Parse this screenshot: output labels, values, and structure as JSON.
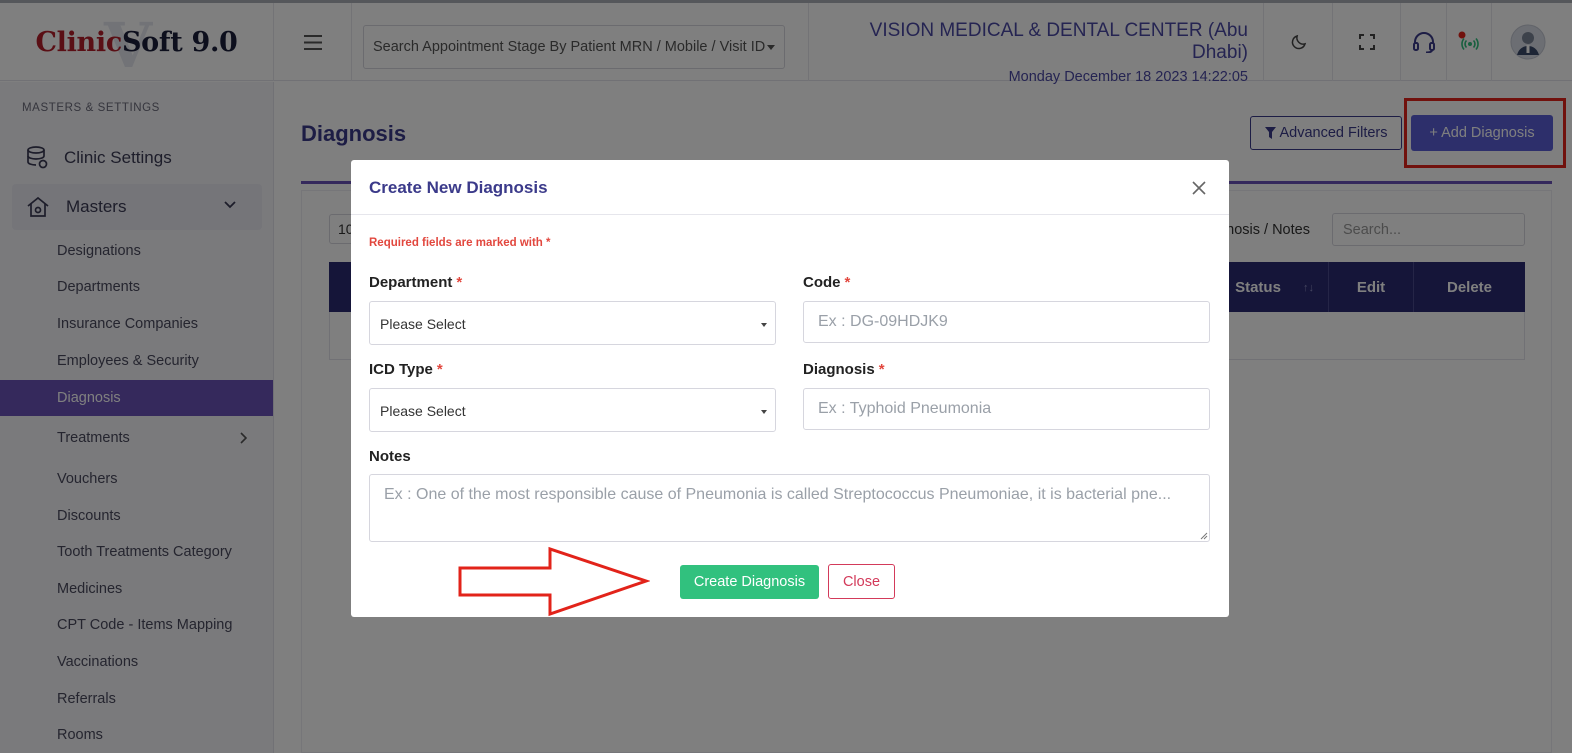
{
  "header": {
    "logo_part1": "Clinic",
    "logo_part2": "Soft",
    "logo_version": " 9.0",
    "logo_watermark": "V",
    "search_placeholder": "Search Appointment Stage By Patient MRN / Mobile / Visit ID",
    "clinic_name": "VISION MEDICAL & DENTAL CENTER (Abu Dhabi)",
    "datetime": "Monday December 18 2023 14:22:05",
    "icons": [
      "menu-icon",
      "moon-icon",
      "fullscreen-icon",
      "headset-icon",
      "broadcast-icon",
      "avatar"
    ]
  },
  "sidebar": {
    "section_title": "MASTERS & SETTINGS",
    "main_items": [
      {
        "label": "Clinic Settings",
        "icon": "database-icon"
      },
      {
        "label": "Masters",
        "icon": "home-icon"
      }
    ],
    "sub_items": [
      {
        "label": "Designations"
      },
      {
        "label": "Departments"
      },
      {
        "label": "Insurance Companies"
      },
      {
        "label": "Employees & Security"
      },
      {
        "label": "Diagnosis",
        "active": true
      },
      {
        "label": "Treatments"
      },
      {
        "label": "Vouchers"
      },
      {
        "label": "Discounts"
      },
      {
        "label": "Tooth Treatments Category"
      },
      {
        "label": "Medicines"
      },
      {
        "label": "CPT Code - Items Mapping"
      },
      {
        "label": "Vaccinations"
      },
      {
        "label": "Referrals"
      },
      {
        "label": "Rooms"
      }
    ]
  },
  "page": {
    "title": "Diagnosis",
    "advanced_filters": "Advanced Filters",
    "add_button": "+ Add Diagnosis",
    "length_value": "10",
    "search_label": "agnosis / Notes",
    "search_placeholder": "Search...",
    "table_headers": [
      "Status",
      "Edit",
      "Delete"
    ]
  },
  "modal": {
    "title": "Create New Diagnosis",
    "required_note": "Required fields are marked with *",
    "department_label": "Department",
    "department_value": "Please Select",
    "code_label": "Code",
    "code_placeholder": "Ex : DG-09HDJK9",
    "icd_label": "ICD Type",
    "icd_value": "Please Select",
    "diagnosis_label": "Diagnosis",
    "diagnosis_placeholder": "Ex : Typhoid Pneumonia",
    "notes_label": "Notes",
    "notes_placeholder": "Ex : One of the most responsible cause of Pneumonia is called Streptococcus Pneumoniae, it is bacterial pne...",
    "required_star": "*",
    "create_button": "Create Diagnosis",
    "close_button": "Close"
  },
  "colors": {
    "primary": "#3b3a8a",
    "active_nav": "#6b53b9",
    "add_button": "#5b5fd6",
    "success": "#31c17e",
    "danger": "#d33a5a",
    "annotation": "#e2231a"
  }
}
